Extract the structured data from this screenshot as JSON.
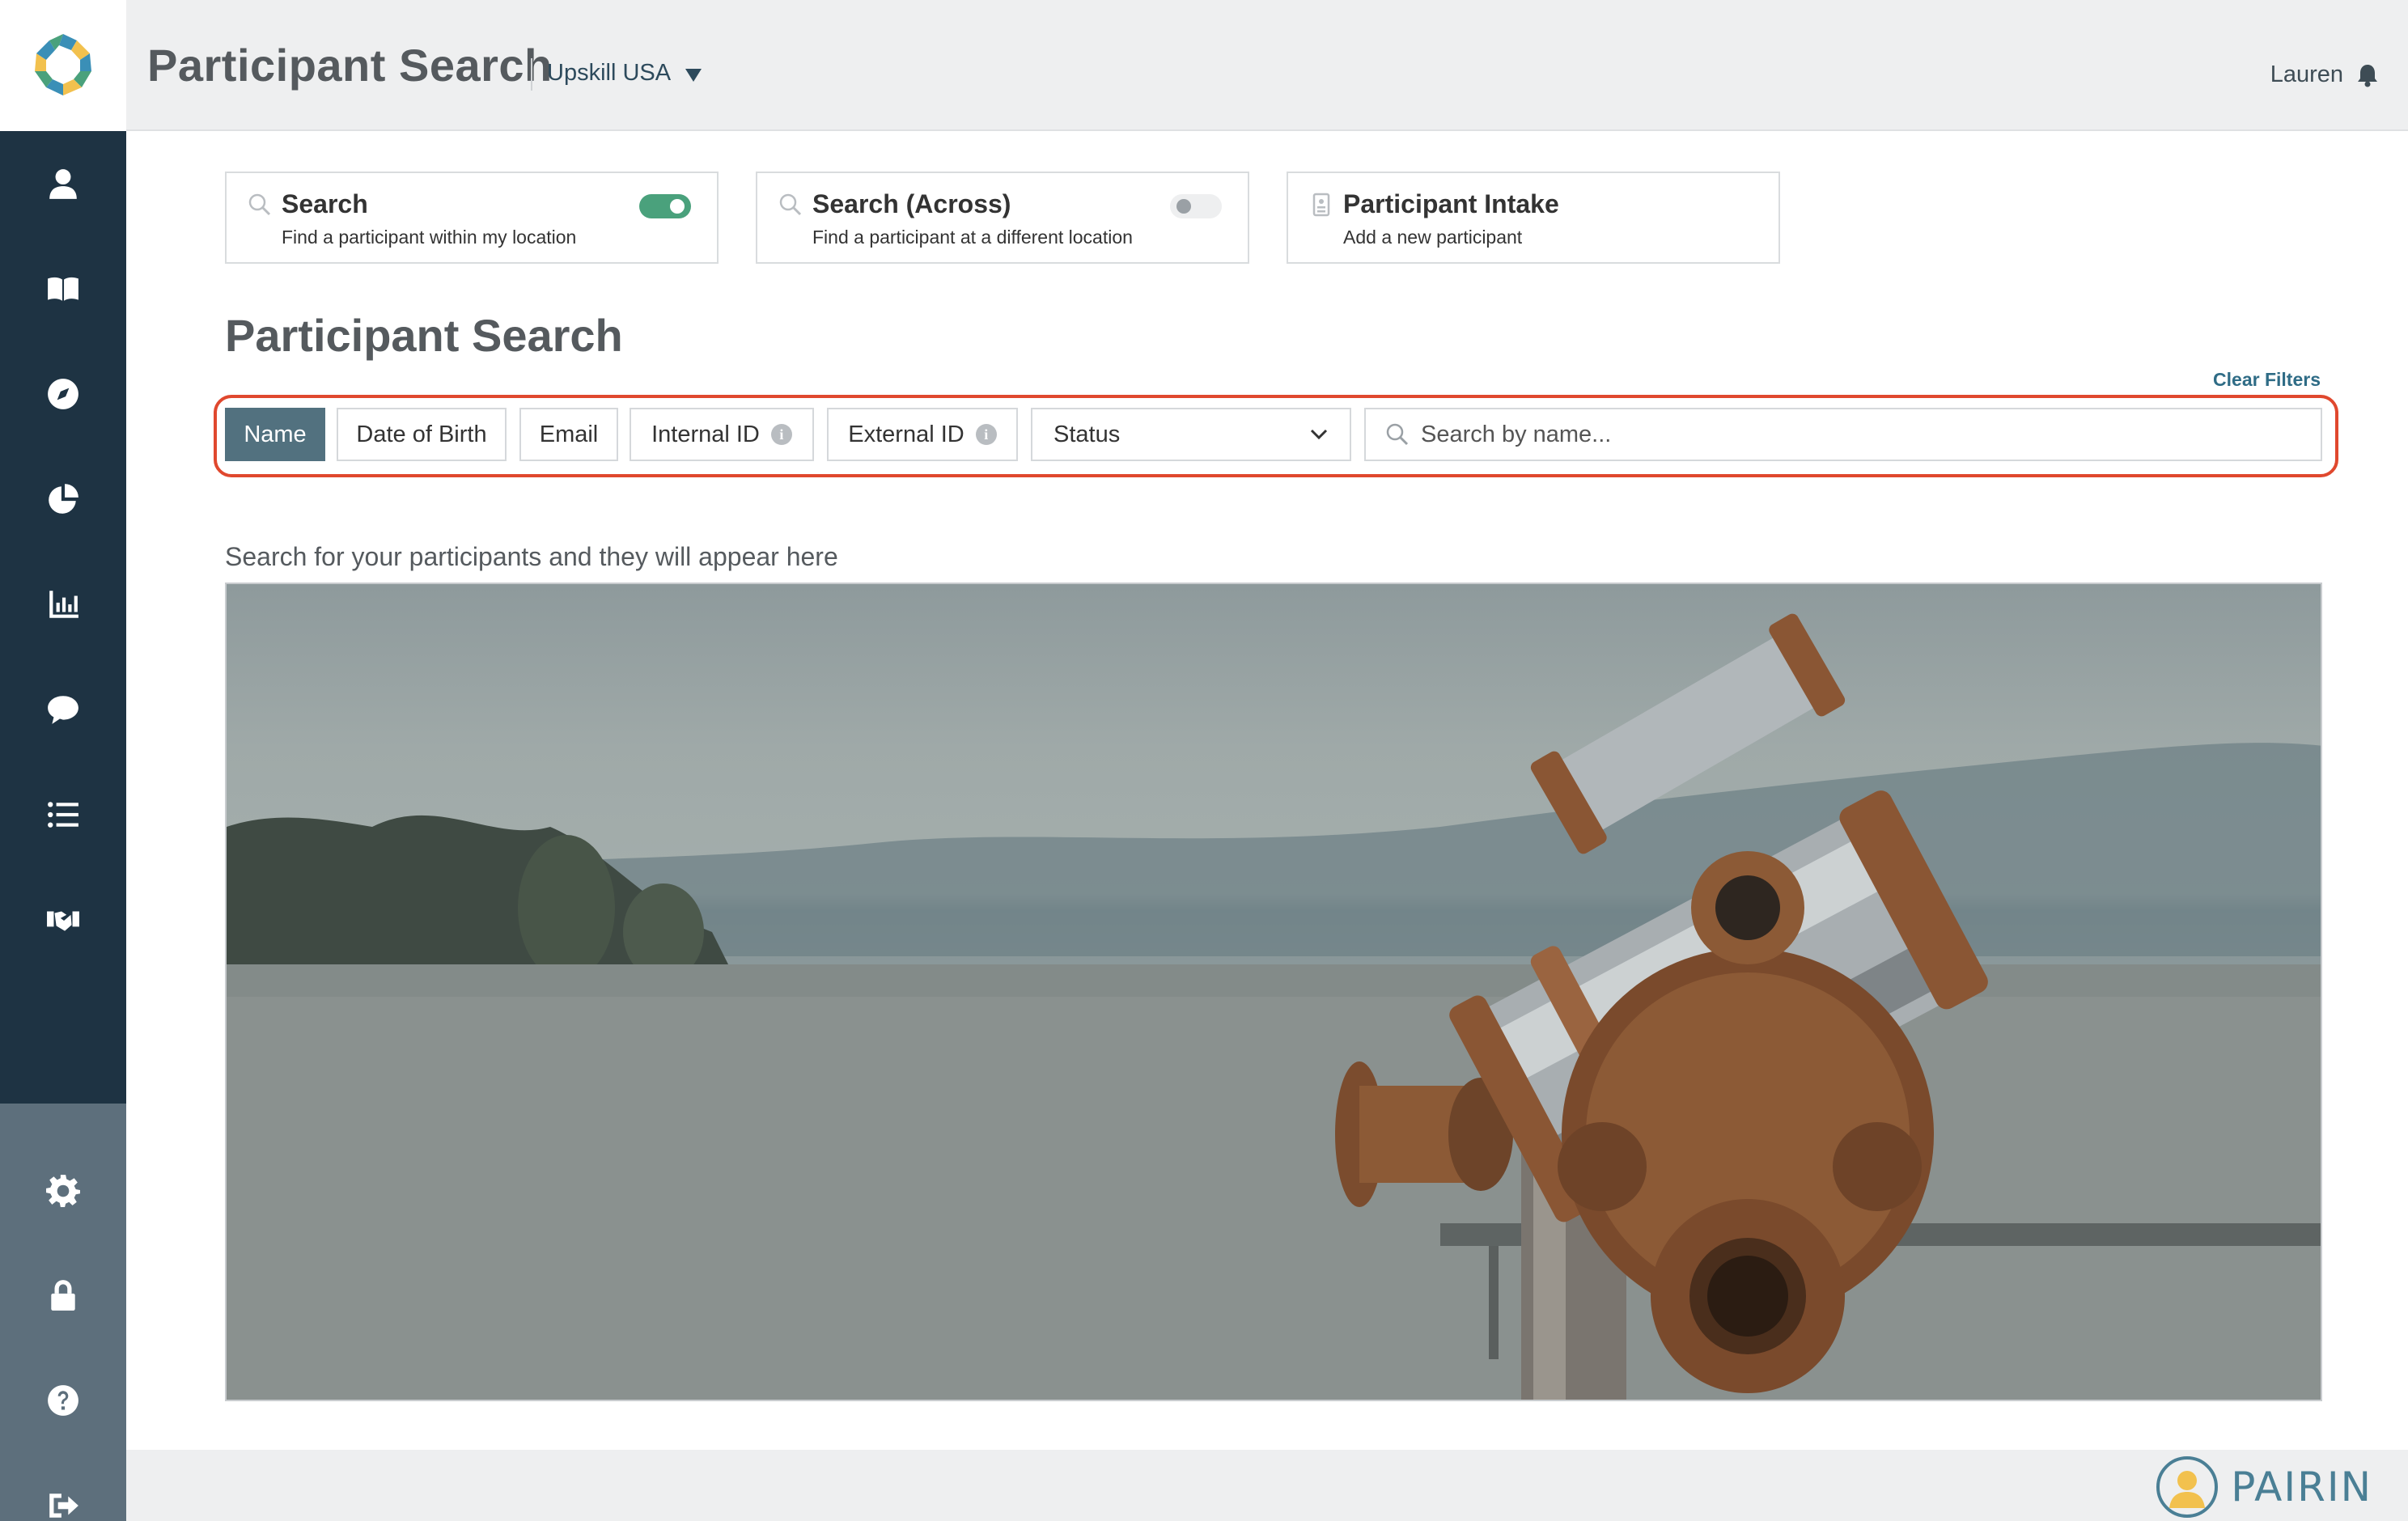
{
  "header": {
    "page_title": "Participant Search",
    "org_name": "Upskill USA",
    "user_name": "Lauren"
  },
  "sidebar": {
    "items": [
      {
        "icon": "person-icon"
      },
      {
        "icon": "book-icon"
      },
      {
        "icon": "compass-icon"
      },
      {
        "icon": "pie-chart-icon"
      },
      {
        "icon": "bar-chart-icon"
      },
      {
        "icon": "chat-bubble-icon"
      },
      {
        "icon": "list-icon"
      },
      {
        "icon": "handshake-icon"
      }
    ],
    "bottom_items": [
      {
        "icon": "gear-icon"
      },
      {
        "icon": "lock-icon"
      },
      {
        "icon": "help-icon"
      },
      {
        "icon": "sign-out-icon"
      }
    ]
  },
  "modes": [
    {
      "title": "Search",
      "subtitle": "Find a participant within my location",
      "toggle_on": true
    },
    {
      "title": "Search (Across)",
      "subtitle": "Find a participant at a different location",
      "toggle_on": false
    },
    {
      "title": "Participant Intake",
      "subtitle": "Add a new participant"
    }
  ],
  "main": {
    "section_title": "Participant Search",
    "clear_filters": "Clear Filters",
    "hint": "Search for your participants and they will appear here"
  },
  "filters": {
    "chips": [
      {
        "label": "Name",
        "active": true
      },
      {
        "label": "Date of Birth"
      },
      {
        "label": "Email"
      },
      {
        "label": "Internal ID",
        "info": "i"
      },
      {
        "label": "External ID",
        "info": "i"
      }
    ],
    "status_label": "Status",
    "search_placeholder": "Search by name..."
  },
  "footer": {
    "brand": "PAIRIN"
  },
  "colors": {
    "sidebar": "#1e3343",
    "sidebar_bottom": "#5d6f7c",
    "active_chip": "#52717f",
    "toggle_on": "#4aa17c",
    "highlight": "#e0482e",
    "link": "#2f6c86"
  }
}
